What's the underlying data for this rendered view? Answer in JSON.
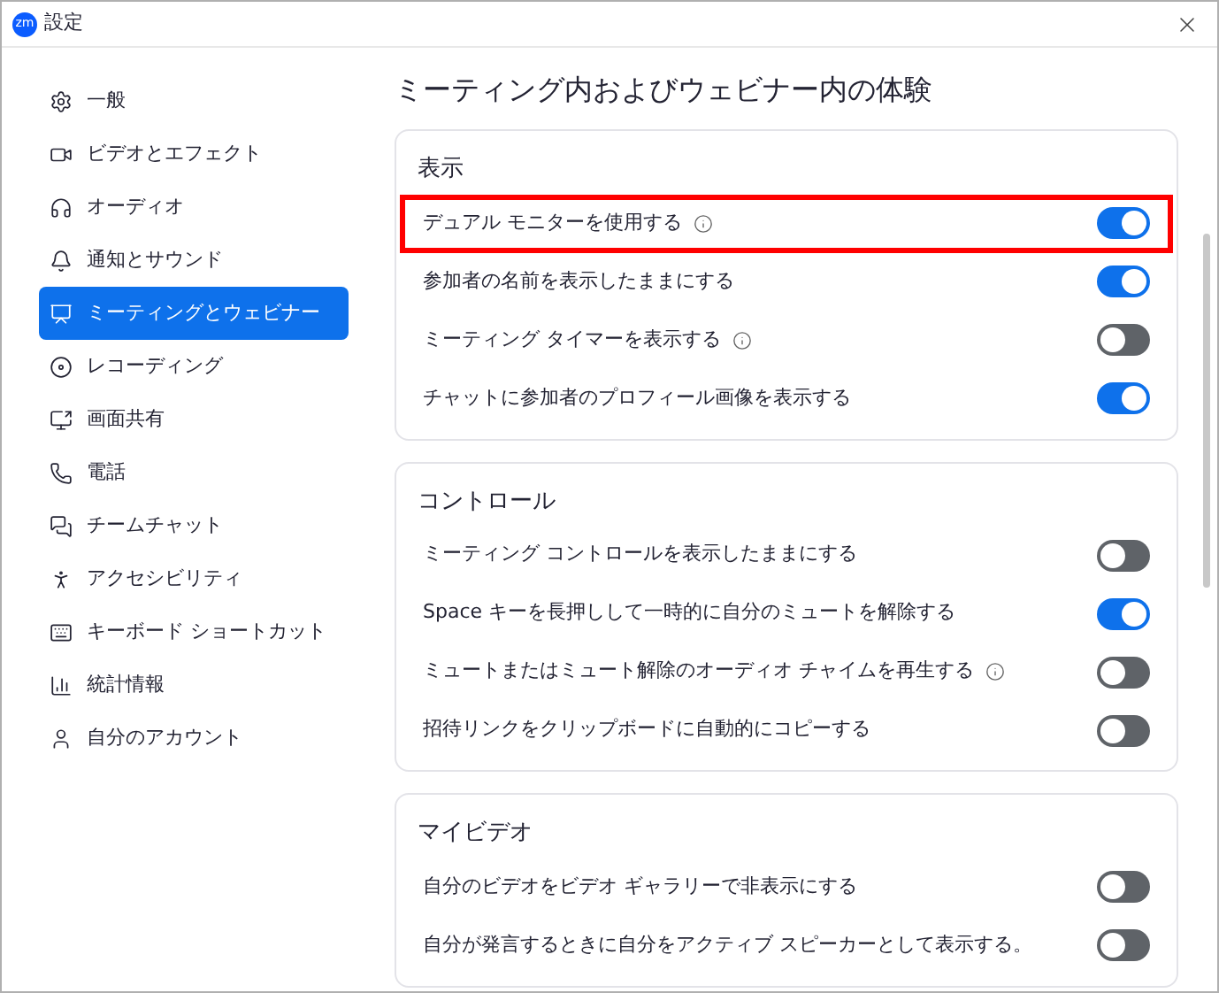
{
  "window": {
    "logo": "zm",
    "title": "設定"
  },
  "sidebar": {
    "items": [
      {
        "label": "一般",
        "selected": false
      },
      {
        "label": "ビデオとエフェクト",
        "selected": false
      },
      {
        "label": "オーディオ",
        "selected": false
      },
      {
        "label": "通知とサウンド",
        "selected": false
      },
      {
        "label": "ミーティングとウェビナー",
        "selected": true
      },
      {
        "label": "レコーディング",
        "selected": false
      },
      {
        "label": "画面共有",
        "selected": false
      },
      {
        "label": "電話",
        "selected": false
      },
      {
        "label": "チームチャット",
        "selected": false
      },
      {
        "label": "アクセシビリティ",
        "selected": false
      },
      {
        "label": "キーボード ショートカット",
        "selected": false
      },
      {
        "label": "統計情報",
        "selected": false
      },
      {
        "label": "自分のアカウント",
        "selected": false
      }
    ]
  },
  "page_title": "ミーティング内およびウェビナー内の体験",
  "sections": [
    {
      "title": "表示",
      "settings": [
        {
          "label": "デュアル モニターを使用する",
          "info": true,
          "on": true,
          "highlighted": true
        },
        {
          "label": "参加者の名前を表示したままにする",
          "info": false,
          "on": true,
          "highlighted": false
        },
        {
          "label": "ミーティング タイマーを表示する",
          "info": true,
          "on": false,
          "highlighted": false
        },
        {
          "label": "チャットに参加者のプロフィール画像を表示する",
          "info": false,
          "on": true,
          "highlighted": false
        }
      ]
    },
    {
      "title": "コントロール",
      "settings": [
        {
          "label": "ミーティング コントロールを表示したままにする",
          "info": false,
          "on": false,
          "highlighted": false
        },
        {
          "label": "Space キーを長押しして一時的に自分のミュートを解除する",
          "info": false,
          "on": true,
          "highlighted": false
        },
        {
          "label": "ミュートまたはミュート解除のオーディオ チャイムを再生する",
          "info": true,
          "on": false,
          "highlighted": false
        },
        {
          "label": "招待リンクをクリップボードに自動的にコピーする",
          "info": false,
          "on": false,
          "highlighted": false
        }
      ]
    },
    {
      "title": "マイビデオ",
      "settings": [
        {
          "label": "自分のビデオをビデオ ギャラリーで非表示にする",
          "info": false,
          "on": false,
          "highlighted": false
        },
        {
          "label": "自分が発言するときに自分をアクティブ スピーカーとして表示する。",
          "info": false,
          "on": false,
          "highlighted": false
        }
      ]
    }
  ]
}
